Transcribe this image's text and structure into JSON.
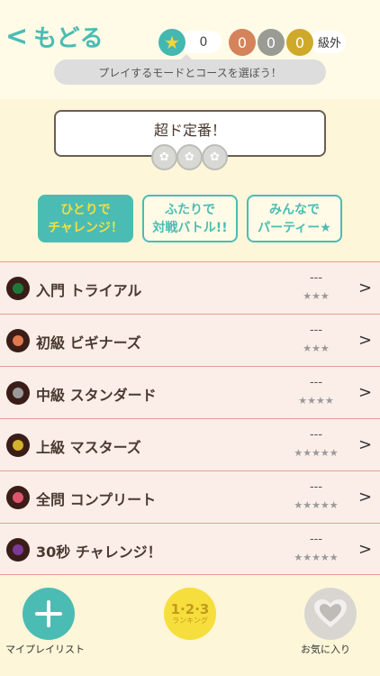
{
  "header": {
    "back_chevron": "<",
    "back_label": "もどる",
    "star_count": "0",
    "medals": {
      "bronze": "0",
      "silver": "0",
      "gold": "0"
    },
    "rank_label": "級外",
    "hint": "プレイするモードとコースを選ぼう！"
  },
  "course": {
    "title": "超ド定番！",
    "rosette_icon": "rosette-icon"
  },
  "modes": [
    {
      "line1": "ひとりで",
      "line2": "チャレンジ！"
    },
    {
      "line1": "ふたりで",
      "line2": "対戦バトル!!"
    },
    {
      "line1": "みんなで",
      "line2": "パーティー★"
    }
  ],
  "levels": [
    {
      "label": "入門 トライアル",
      "score": "---",
      "stars": "★★★",
      "dot_color": "#1f7a3a"
    },
    {
      "label": "初級 ビギナーズ",
      "score": "---",
      "stars": "★★★",
      "dot_color": "#e07a4e"
    },
    {
      "label": "中級 スタンダード",
      "score": "---",
      "stars": "★★★★",
      "dot_color": "#9a9a9a"
    },
    {
      "label": "上級 マスターズ",
      "score": "---",
      "stars": "★★★★★",
      "dot_color": "#d4b22a"
    },
    {
      "label": "全問 コンプリート",
      "score": "---",
      "stars": "★★★★★",
      "dot_color": "#e0556e"
    },
    {
      "label": "30秒 チャレンジ！",
      "score": "---",
      "stars": "★★★★★",
      "dot_color": "#7a3a9a"
    }
  ],
  "row_arrow": ">",
  "bottom": {
    "playlist_label": "マイプレイリスト",
    "ranking_num": "1·2·3",
    "ranking_sub": "ランキング",
    "favorite_label": "お気に入り"
  },
  "colors": {
    "accent": "#4bbcb4",
    "highlight": "#f6de3c",
    "background": "#fdf6d9",
    "row_bg": "#fbeee9",
    "row_border": "#e3a08f"
  }
}
